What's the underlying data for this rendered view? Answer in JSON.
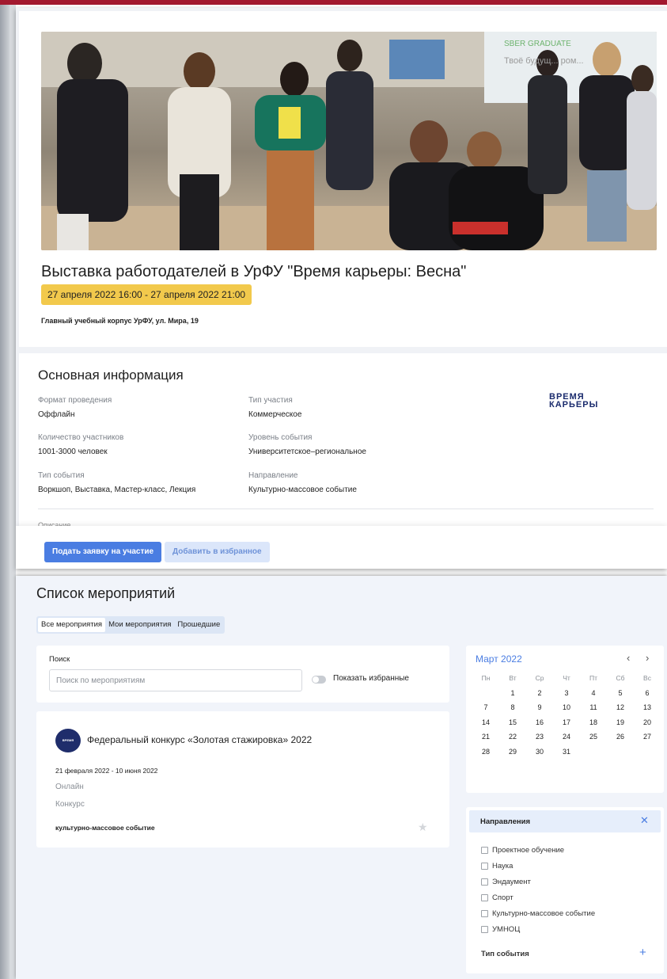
{
  "colors": {
    "accent": "#4a7de2",
    "badge": "#f2c94c",
    "brand_red": "#a3192f",
    "logo_navy": "#1f2d6b"
  },
  "event": {
    "title": "Выставка работодателей в УрФУ \"Время карьеры: Весна\"",
    "dates": "27 апреля 2022 16:00 - 27 апреля 2022 21:00",
    "location": "Главный учебный корпус УрФУ, ул. Мира, 19",
    "hero_banner_text": "SBER GRADUATE",
    "hero_poster_text": "Твоё будущ... ром..."
  },
  "info": {
    "title": "Основная информация",
    "brand_logo": [
      "ВРЕМЯ",
      "КАРЬЕРЫ"
    ],
    "fields": [
      {
        "label": "Формат проведения",
        "value": "Оффлайн"
      },
      {
        "label": "Тип участия",
        "value": "Коммерческое"
      },
      {
        "label": "Количество участников",
        "value": "1001-3000 человек"
      },
      {
        "label": "Уровень события",
        "value": "Университетское–региональное"
      },
      {
        "label": "Тип события",
        "value": "Воркшоп, Выставка, Мастер-класс, Лекция"
      },
      {
        "label": "Направление",
        "value": "Культурно-массовое событие"
      }
    ],
    "description_label": "Описание"
  },
  "actions": {
    "apply": "Подать заявку на участие",
    "favorite": "Добавить в избранное"
  },
  "list": {
    "title": "Список мероприятий",
    "tabs": [
      "Все мероприятия",
      "Мои мероприятия",
      "Прошедшие"
    ],
    "search_label": "Поиск",
    "search_placeholder": "Поиск по мероприятиям",
    "search_value": "",
    "show_favorites": "Показать избранные",
    "show_favorites_on": false
  },
  "card": {
    "logo_text": "ВРЕМЯ КАРЬЕРЫ",
    "title": "Федеральный конкурс «Золотая стажировка» 2022",
    "dates": "21 февраля 2022 - 10 июня 2022",
    "format": "Онлайн",
    "type": "Конкурс",
    "direction": "культурно-массовое событие"
  },
  "calendar": {
    "month": "Март 2022",
    "weekdays": [
      "Пн",
      "Вт",
      "Ср",
      "Чт",
      "Пт",
      "Сб",
      "Вс"
    ],
    "weeks": [
      [
        "",
        "1",
        "2",
        "3",
        "4",
        "5",
        "6"
      ],
      [
        "7",
        "8",
        "9",
        "10",
        "11",
        "12",
        "13"
      ],
      [
        "14",
        "15",
        "16",
        "17",
        "18",
        "19",
        "20"
      ],
      [
        "21",
        "22",
        "23",
        "24",
        "25",
        "26",
        "27"
      ],
      [
        "28",
        "29",
        "30",
        "31",
        "",
        "",
        ""
      ]
    ]
  },
  "filters": {
    "directions_label": "Направления",
    "directions": [
      "Проектное обучение",
      "Наука",
      "Эндаумент",
      "Спорт",
      "Культурно-массовое событие",
      "УМНОЦ"
    ],
    "event_type_label": "Тип события"
  },
  "icons": {
    "prev": "chevron-left-icon",
    "next": "chevron-right-icon",
    "close": "close-icon",
    "plus": "plus-icon",
    "star": "star-icon"
  }
}
